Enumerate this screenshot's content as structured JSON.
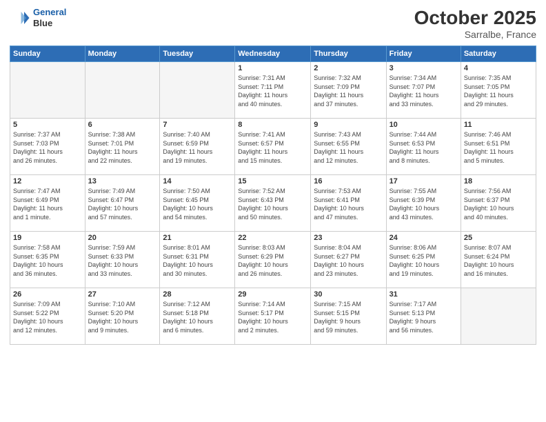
{
  "header": {
    "logo_line1": "General",
    "logo_line2": "Blue",
    "month": "October 2025",
    "location": "Sarralbe, France"
  },
  "weekdays": [
    "Sunday",
    "Monday",
    "Tuesday",
    "Wednesday",
    "Thursday",
    "Friday",
    "Saturday"
  ],
  "weeks": [
    [
      {
        "day": "",
        "empty": true
      },
      {
        "day": "",
        "empty": true
      },
      {
        "day": "",
        "empty": true
      },
      {
        "day": "1",
        "info": "Sunrise: 7:31 AM\nSunset: 7:11 PM\nDaylight: 11 hours\nand 40 minutes."
      },
      {
        "day": "2",
        "info": "Sunrise: 7:32 AM\nSunset: 7:09 PM\nDaylight: 11 hours\nand 37 minutes."
      },
      {
        "day": "3",
        "info": "Sunrise: 7:34 AM\nSunset: 7:07 PM\nDaylight: 11 hours\nand 33 minutes."
      },
      {
        "day": "4",
        "info": "Sunrise: 7:35 AM\nSunset: 7:05 PM\nDaylight: 11 hours\nand 29 minutes."
      }
    ],
    [
      {
        "day": "5",
        "info": "Sunrise: 7:37 AM\nSunset: 7:03 PM\nDaylight: 11 hours\nand 26 minutes."
      },
      {
        "day": "6",
        "info": "Sunrise: 7:38 AM\nSunset: 7:01 PM\nDaylight: 11 hours\nand 22 minutes."
      },
      {
        "day": "7",
        "info": "Sunrise: 7:40 AM\nSunset: 6:59 PM\nDaylight: 11 hours\nand 19 minutes."
      },
      {
        "day": "8",
        "info": "Sunrise: 7:41 AM\nSunset: 6:57 PM\nDaylight: 11 hours\nand 15 minutes."
      },
      {
        "day": "9",
        "info": "Sunrise: 7:43 AM\nSunset: 6:55 PM\nDaylight: 11 hours\nand 12 minutes."
      },
      {
        "day": "10",
        "info": "Sunrise: 7:44 AM\nSunset: 6:53 PM\nDaylight: 11 hours\nand 8 minutes."
      },
      {
        "day": "11",
        "info": "Sunrise: 7:46 AM\nSunset: 6:51 PM\nDaylight: 11 hours\nand 5 minutes."
      }
    ],
    [
      {
        "day": "12",
        "info": "Sunrise: 7:47 AM\nSunset: 6:49 PM\nDaylight: 11 hours\nand 1 minute."
      },
      {
        "day": "13",
        "info": "Sunrise: 7:49 AM\nSunset: 6:47 PM\nDaylight: 10 hours\nand 57 minutes."
      },
      {
        "day": "14",
        "info": "Sunrise: 7:50 AM\nSunset: 6:45 PM\nDaylight: 10 hours\nand 54 minutes."
      },
      {
        "day": "15",
        "info": "Sunrise: 7:52 AM\nSunset: 6:43 PM\nDaylight: 10 hours\nand 50 minutes."
      },
      {
        "day": "16",
        "info": "Sunrise: 7:53 AM\nSunset: 6:41 PM\nDaylight: 10 hours\nand 47 minutes."
      },
      {
        "day": "17",
        "info": "Sunrise: 7:55 AM\nSunset: 6:39 PM\nDaylight: 10 hours\nand 43 minutes."
      },
      {
        "day": "18",
        "info": "Sunrise: 7:56 AM\nSunset: 6:37 PM\nDaylight: 10 hours\nand 40 minutes."
      }
    ],
    [
      {
        "day": "19",
        "info": "Sunrise: 7:58 AM\nSunset: 6:35 PM\nDaylight: 10 hours\nand 36 minutes."
      },
      {
        "day": "20",
        "info": "Sunrise: 7:59 AM\nSunset: 6:33 PM\nDaylight: 10 hours\nand 33 minutes."
      },
      {
        "day": "21",
        "info": "Sunrise: 8:01 AM\nSunset: 6:31 PM\nDaylight: 10 hours\nand 30 minutes."
      },
      {
        "day": "22",
        "info": "Sunrise: 8:03 AM\nSunset: 6:29 PM\nDaylight: 10 hours\nand 26 minutes."
      },
      {
        "day": "23",
        "info": "Sunrise: 8:04 AM\nSunset: 6:27 PM\nDaylight: 10 hours\nand 23 minutes."
      },
      {
        "day": "24",
        "info": "Sunrise: 8:06 AM\nSunset: 6:25 PM\nDaylight: 10 hours\nand 19 minutes."
      },
      {
        "day": "25",
        "info": "Sunrise: 8:07 AM\nSunset: 6:24 PM\nDaylight: 10 hours\nand 16 minutes."
      }
    ],
    [
      {
        "day": "26",
        "info": "Sunrise: 7:09 AM\nSunset: 5:22 PM\nDaylight: 10 hours\nand 12 minutes."
      },
      {
        "day": "27",
        "info": "Sunrise: 7:10 AM\nSunset: 5:20 PM\nDaylight: 10 hours\nand 9 minutes."
      },
      {
        "day": "28",
        "info": "Sunrise: 7:12 AM\nSunset: 5:18 PM\nDaylight: 10 hours\nand 6 minutes."
      },
      {
        "day": "29",
        "info": "Sunrise: 7:14 AM\nSunset: 5:17 PM\nDaylight: 10 hours\nand 2 minutes."
      },
      {
        "day": "30",
        "info": "Sunrise: 7:15 AM\nSunset: 5:15 PM\nDaylight: 9 hours\nand 59 minutes."
      },
      {
        "day": "31",
        "info": "Sunrise: 7:17 AM\nSunset: 5:13 PM\nDaylight: 9 hours\nand 56 minutes."
      },
      {
        "day": "",
        "empty": true
      }
    ]
  ]
}
